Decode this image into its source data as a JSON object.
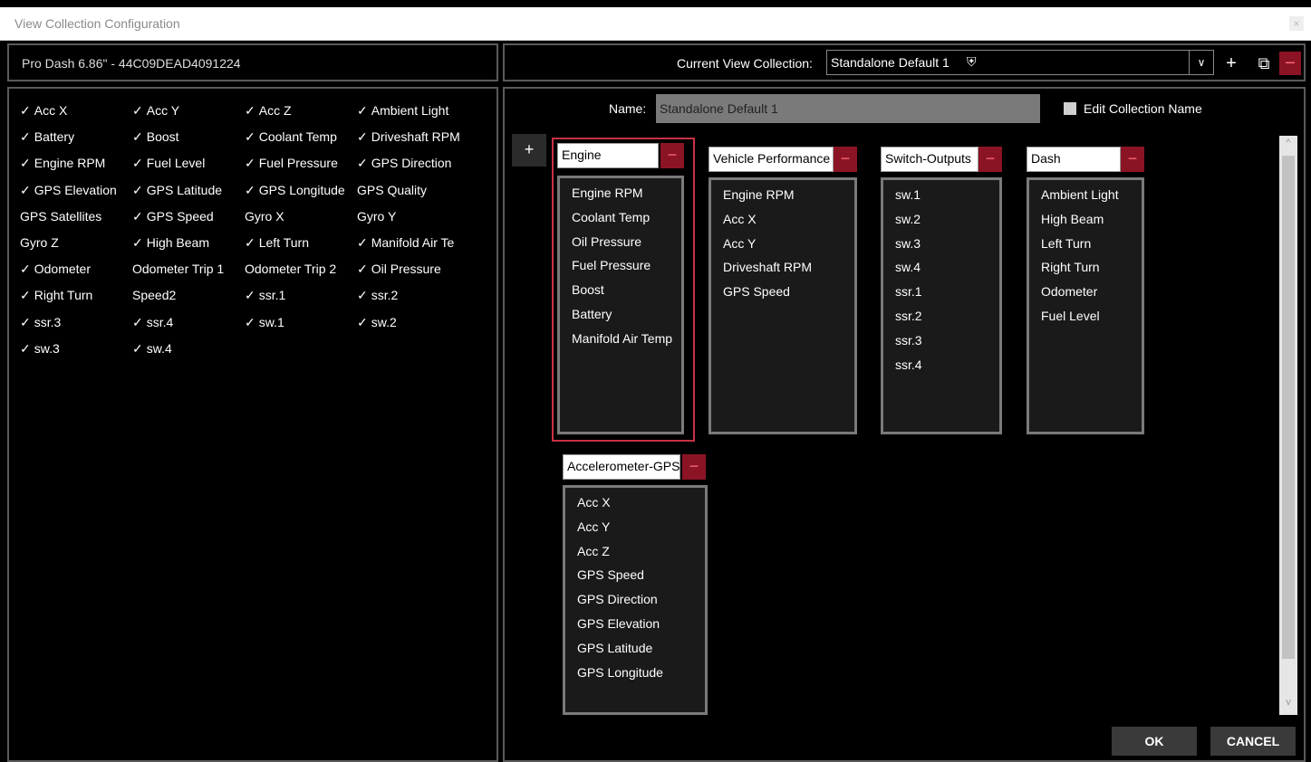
{
  "window": {
    "title": "View Collection Configuration",
    "close_glyph": "×"
  },
  "device": {
    "label": "Pro Dash 6.86\" - 44C09DEAD4091224"
  },
  "toolbar": {
    "current_label": "Current View Collection:",
    "current_value": "Standalone Default 1",
    "shield_glyph": "⛨",
    "dropdown_glyph": "∨",
    "add_glyph": "+",
    "copy_glyph": "⧉",
    "delete_glyph": "−"
  },
  "available_channels": [
    {
      "label": "Acc X",
      "checked": true
    },
    {
      "label": "Acc Y",
      "checked": true
    },
    {
      "label": "Acc Z",
      "checked": true
    },
    {
      "label": "Ambient Light",
      "checked": true
    },
    {
      "label": "Battery",
      "checked": true
    },
    {
      "label": "Boost",
      "checked": true
    },
    {
      "label": "Coolant Temp",
      "checked": true
    },
    {
      "label": "Driveshaft RPM",
      "checked": true
    },
    {
      "label": "Engine RPM",
      "checked": true
    },
    {
      "label": "Fuel Level",
      "checked": true
    },
    {
      "label": "Fuel Pressure",
      "checked": true
    },
    {
      "label": "GPS Direction",
      "checked": true
    },
    {
      "label": "GPS Elevation",
      "checked": true
    },
    {
      "label": "GPS Latitude",
      "checked": true
    },
    {
      "label": "GPS Longitude",
      "checked": true
    },
    {
      "label": "GPS Quality",
      "checked": false
    },
    {
      "label": "GPS Satellites",
      "checked": false
    },
    {
      "label": "GPS Speed",
      "checked": true
    },
    {
      "label": "Gyro X",
      "checked": false
    },
    {
      "label": "Gyro Y",
      "checked": false
    },
    {
      "label": "Gyro Z",
      "checked": false
    },
    {
      "label": "High Beam",
      "checked": true
    },
    {
      "label": "Left Turn",
      "checked": true
    },
    {
      "label": "Manifold Air Te",
      "checked": true
    },
    {
      "label": "Odometer",
      "checked": true
    },
    {
      "label": "Odometer Trip 1",
      "checked": false
    },
    {
      "label": "Odometer Trip 2",
      "checked": false
    },
    {
      "label": "Oil Pressure",
      "checked": true
    },
    {
      "label": "Right Turn",
      "checked": true
    },
    {
      "label": "Speed2",
      "checked": false
    },
    {
      "label": "ssr.1",
      "checked": true
    },
    {
      "label": "ssr.2",
      "checked": true
    },
    {
      "label": "ssr.3",
      "checked": true
    },
    {
      "label": "ssr.4",
      "checked": true
    },
    {
      "label": "sw.1",
      "checked": true
    },
    {
      "label": "sw.2",
      "checked": true
    },
    {
      "label": "sw.3",
      "checked": true
    },
    {
      "label": "sw.4",
      "checked": true
    }
  ],
  "check_glyph": "✓",
  "editor": {
    "name_label": "Name:",
    "name_value": "Standalone Default 1",
    "edit_name_label": "Edit Collection Name",
    "add_group_glyph": "+",
    "delete_glyph": "−",
    "scroll_up_glyph": "^",
    "scroll_down_glyph": "v",
    "groups": [
      {
        "name": "Engine",
        "selected": true,
        "items": [
          "Engine RPM",
          "Coolant Temp",
          "Oil Pressure",
          "Fuel Pressure",
          "Boost",
          "Battery",
          "Manifold Air Temp"
        ]
      },
      {
        "name": "Vehicle Performance",
        "selected": false,
        "items": [
          "Engine RPM",
          "Acc X",
          "Acc Y",
          "Driveshaft RPM",
          "GPS Speed"
        ]
      },
      {
        "name": "Switch-Outputs",
        "selected": false,
        "items": [
          "sw.1",
          "sw.2",
          "sw.3",
          "sw.4",
          "ssr.1",
          "ssr.2",
          "ssr.3",
          "ssr.4"
        ]
      },
      {
        "name": "Dash",
        "selected": false,
        "items": [
          "Ambient Light",
          "High Beam",
          "Left Turn",
          "Right Turn",
          "Odometer",
          "Fuel Level"
        ]
      },
      {
        "name": "Accelerometer-GPS",
        "selected": false,
        "items": [
          "Acc X",
          "Acc Y",
          "Acc Z",
          "GPS Speed",
          "GPS Direction",
          "GPS Elevation",
          "GPS Latitude",
          "GPS Longitude"
        ]
      }
    ]
  },
  "buttons": {
    "ok": "OK",
    "cancel": "CANCEL"
  },
  "colors": {
    "accent_red": "#8b1424",
    "selection_outline": "#c73145"
  }
}
